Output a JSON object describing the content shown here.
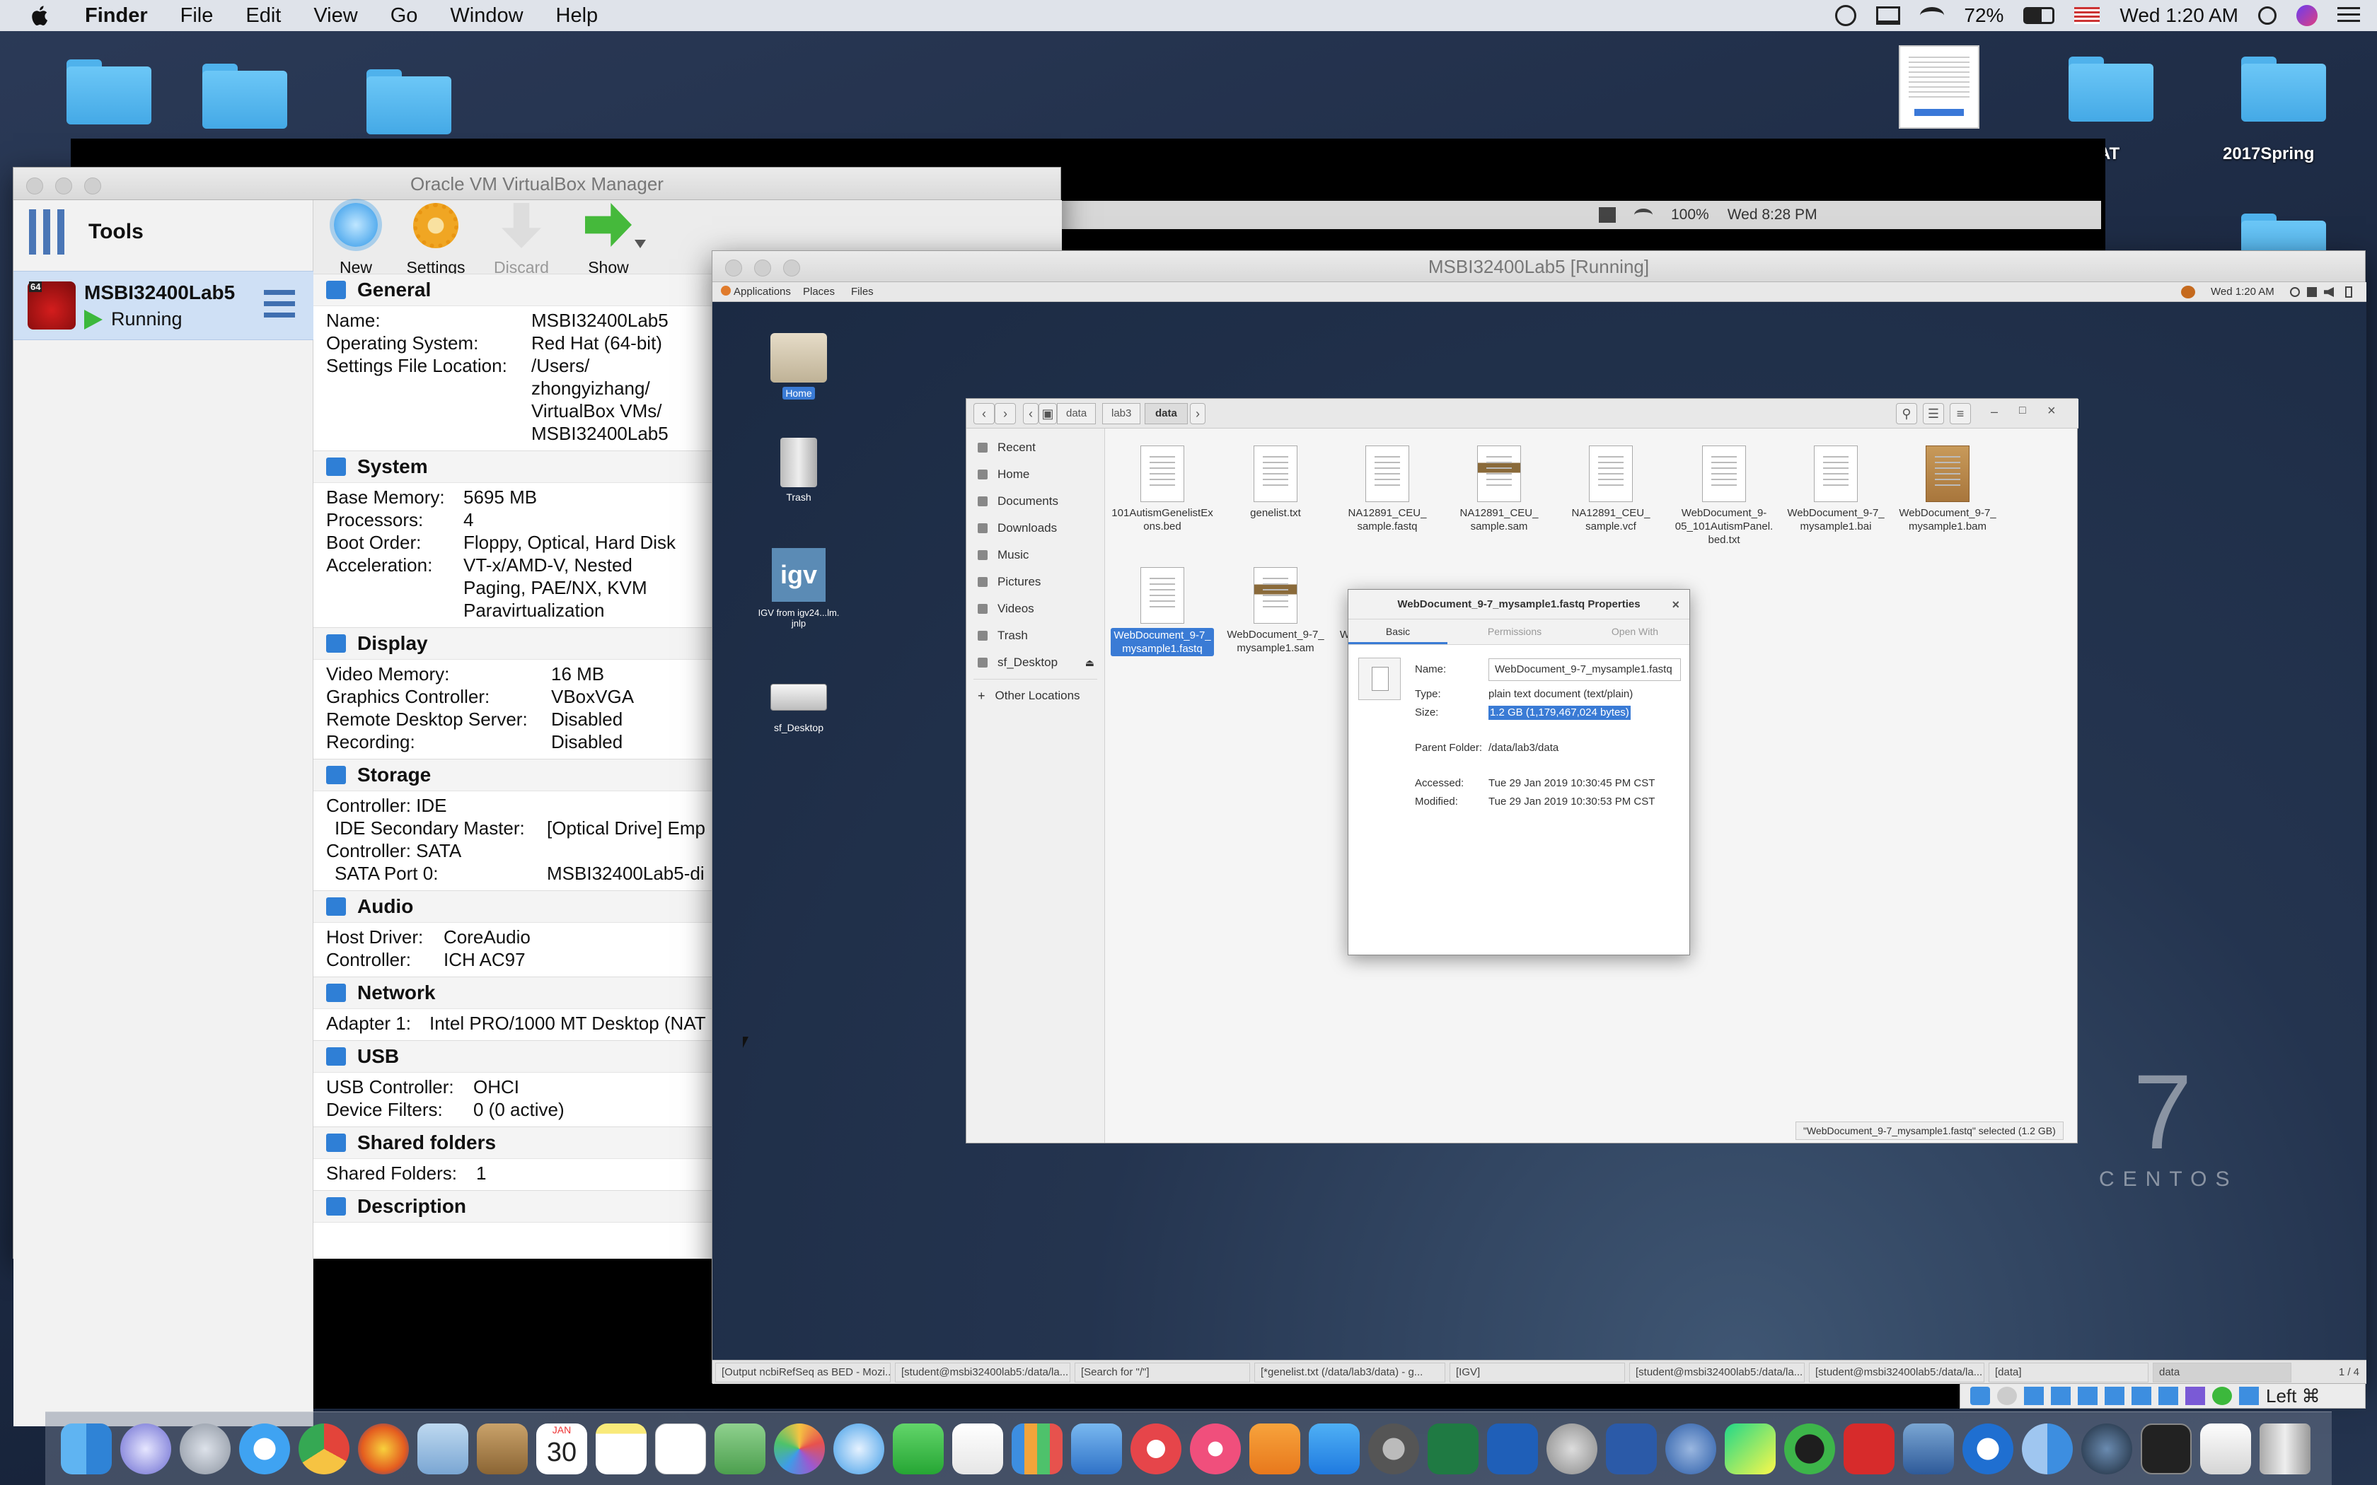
{
  "menubar": {
    "app_name": "Finder",
    "items": [
      "File",
      "Edit",
      "View",
      "Go",
      "Window",
      "Help"
    ],
    "battery": "72%",
    "clock": "Wed 1:20 AM"
  },
  "desktop": {
    "labels": {
      "at": "AT",
      "spring": "2017Spring"
    }
  },
  "guest_host_bar": {
    "battery": "100%",
    "clock": "Wed 8:28 PM"
  },
  "virtualbox": {
    "title": "Oracle VM VirtualBox Manager",
    "tools_label": "Tools",
    "vm": {
      "name": "MSBI32400Lab5",
      "state": "Running",
      "badge": "64"
    },
    "toolbar": {
      "new": "New",
      "settings": "Settings",
      "discard": "Discard",
      "show": "Show"
    },
    "sections": {
      "general": {
        "title": "General",
        "name_k": "Name:",
        "name_v": "MSBI32400Lab5",
        "os_k": "Operating System:",
        "os_v": "Red Hat (64-bit)",
        "loc_k": "Settings File Location:",
        "loc_v1": "/Users/",
        "loc_v2": "zhongyizhang/",
        "loc_v3": "VirtualBox VMs/",
        "loc_v4": "MSBI32400Lab5"
      },
      "system": {
        "title": "System",
        "mem_k": "Base Memory:",
        "mem_v": "5695 MB",
        "proc_k": "Processors:",
        "proc_v": "4",
        "boot_k": "Boot Order:",
        "boot_v": "Floppy, Optical, Hard Disk",
        "acc_k": "Acceleration:",
        "acc_v1": "VT-x/AMD-V, Nested",
        "acc_v2": "Paging, PAE/NX, KVM",
        "acc_v3": "Paravirtualization"
      },
      "display": {
        "title": "Display",
        "vm_k": "Video Memory:",
        "vm_v": "16 MB",
        "gc_k": "Graphics Controller:",
        "gc_v": "VBoxVGA",
        "rds_k": "Remote Desktop Server:",
        "rds_v": "Disabled",
        "rec_k": "Recording:",
        "rec_v": "Disabled"
      },
      "storage": {
        "title": "Storage",
        "l1": "Controller: IDE",
        "l2_k": "IDE Secondary Master:",
        "l2_v": "[Optical Drive] Emp",
        "l3": "Controller: SATA",
        "l4_k": "SATA Port 0:",
        "l4_v": "MSBI32400Lab5-di"
      },
      "audio": {
        "title": "Audio",
        "hd_k": "Host Driver:",
        "hd_v": "CoreAudio",
        "c_k": "Controller:",
        "c_v": "ICH AC97"
      },
      "network": {
        "title": "Network",
        "a1_k": "Adapter 1:",
        "a1_v": "Intel PRO/1000 MT Desktop (NAT"
      },
      "usb": {
        "title": "USB",
        "uc_k": "USB Controller:",
        "uc_v": "OHCI",
        "df_k": "Device Filters:",
        "df_v": "0 (0 active)"
      },
      "shared": {
        "title": "Shared folders",
        "sf_k": "Shared Folders:",
        "sf_v": "1"
      },
      "description": {
        "title": "Description"
      }
    }
  },
  "vm_window": {
    "title": "MSBI32400Lab5 [Running]",
    "topbar": {
      "applications": "Applications",
      "places": "Places",
      "files": "Files",
      "clock": "Wed 1:20 AM"
    },
    "desktop_icons": {
      "home": "Home",
      "trash": "Trash",
      "igv": "IGV from igv24...lm.",
      "igv2": "jnlp",
      "sfdesktop": "sf_Desktop"
    },
    "centos": {
      "seven": "7",
      "name": "CENTOS"
    },
    "files_app": {
      "path": [
        "data",
        "lab3",
        "data"
      ],
      "sidebar": [
        "Recent",
        "Home",
        "Documents",
        "Downloads",
        "Music",
        "Pictures",
        "Videos",
        "Trash",
        "sf_Desktop",
        "Other Locations"
      ],
      "files": [
        {
          "l1": "101AutismGenelistEx",
          "l2": "ons.bed",
          "l3": ""
        },
        {
          "l1": "genelist.txt",
          "l2": "",
          "l3": ""
        },
        {
          "l1": "NA12891_CEU_",
          "l2": "sample.fastq",
          "l3": ""
        },
        {
          "l1": "NA12891_CEU_",
          "l2": "sample.sam",
          "l3": ""
        },
        {
          "l1": "NA12891_CEU_",
          "l2": "sample.vcf",
          "l3": ""
        },
        {
          "l1": "WebDocument_9-",
          "l2": "05_101AutismPanel.",
          "l3": "bed.txt"
        },
        {
          "l1": "WebDocument_9-7_",
          "l2": "mysample1.bai",
          "l3": ""
        },
        {
          "l1": "WebDocument_9-7_",
          "l2": "mysample1.bam",
          "l3": ""
        },
        {
          "l1": "WebDocument_9-7_",
          "l2": "mysample1.fastq",
          "l3": ""
        },
        {
          "l1": "WebDocument_9-7_",
          "l2": "mysample1.sam",
          "l3": ""
        },
        {
          "l1": "W",
          "l2": "",
          "l3": ""
        }
      ],
      "status": "\"WebDocument_9-7_mysample1.fastq\" selected (1.2 GB)"
    },
    "properties": {
      "title": "WebDocument_9-7_mysample1.fastq Properties",
      "tabs": [
        "Basic",
        "Permissions",
        "Open With"
      ],
      "name_k": "Name:",
      "name_v": "WebDocument_9-7_mysample1.fastq",
      "type_k": "Type:",
      "type_v": "plain text document (text/plain)",
      "size_k": "Size:",
      "size_v": "1.2 GB (1,179,467,024 bytes)",
      "parent_k": "Parent Folder:",
      "parent_v": "/data/lab3/data",
      "acc_k": "Accessed:",
      "acc_v": "Tue 29 Jan 2019 10:30:45 PM CST",
      "mod_k": "Modified:",
      "mod_v": "Tue 29 Jan 2019 10:30:53 PM CST"
    },
    "taskbar": [
      "[Output ncbiRefSeq as BED - Mozi...",
      "[student@msbi32400lab5:/data/la...",
      "[Search for \"/\"]",
      "[*genelist.txt (/data/lab3/data) - g...",
      "[IGV]",
      "[student@msbi32400lab5:/data/la...",
      "[student@msbi32400lab5:/data/la...",
      "[data]",
      "data"
    ],
    "workspace": "1 / 4",
    "host_key": "Left ⌘"
  },
  "dock": {
    "calendar_month": "JAN",
    "calendar_day": "30"
  }
}
